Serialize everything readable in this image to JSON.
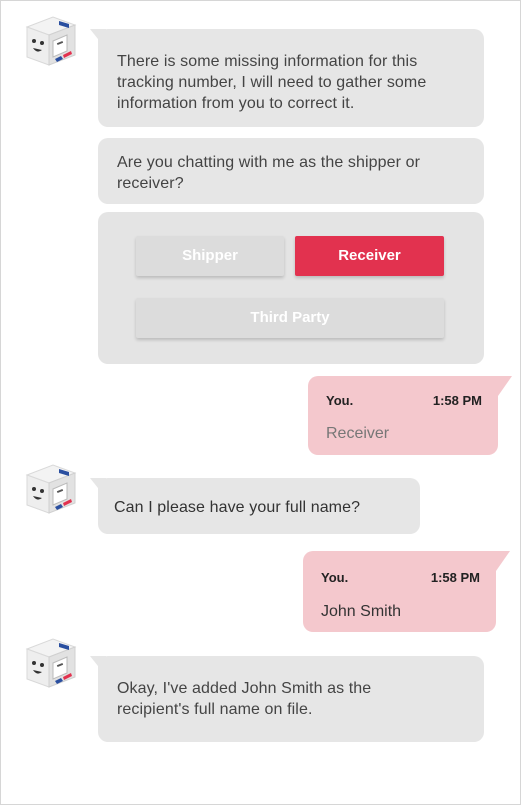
{
  "chat": {
    "bot_messages": [
      "There is some missing information for this tracking number, I will need to gather some information from you to correct it.",
      "Are you chatting with me as the shipper or receiver?",
      "Can I please have your full name?",
      "Okay, I've added John Smith as the recipient's full name on file."
    ],
    "choices": {
      "shipper": "Shipper",
      "receiver": "Receiver",
      "third_party": "Third Party",
      "selected": "Receiver"
    },
    "user_messages": [
      {
        "sender": "You.",
        "time": "1:58 PM",
        "text": "Receiver"
      },
      {
        "sender": "You.",
        "time": "1:58 PM",
        "text": "John Smith"
      }
    ]
  },
  "colors": {
    "bot_bubble": "#e6e6e6",
    "user_bubble": "#f4c8cd",
    "accent": "#e2324f",
    "button_inactive": "#dcdcdc"
  },
  "icons": [
    "bot-avatar-icon"
  ]
}
